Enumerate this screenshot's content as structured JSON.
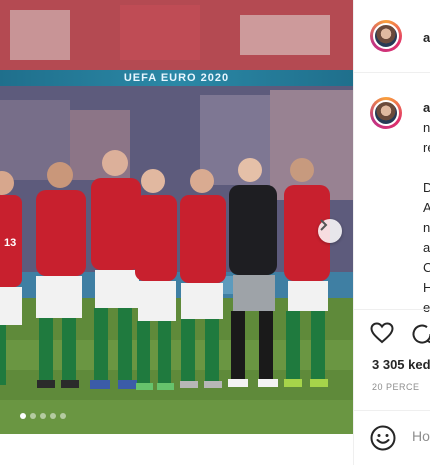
{
  "post": {
    "image_alt": "Hungary national football team lining up before a UEFA EURO 2020 match",
    "stadium_banner": "UEFA EURO 2020",
    "carousel": {
      "count": 5,
      "active_index": 0
    },
    "next_icon": "chevron-right-icon"
  },
  "header": {
    "username": "ad",
    "avatar_icon": "profile-avatar"
  },
  "caption": {
    "username": "a",
    "lines": [
      "n",
      "re",
      "",
      "D",
      "A",
      "n",
      "a",
      "C",
      "H",
      "e"
    ]
  },
  "actions": {
    "like_icon": "heart-icon",
    "comment_icon": "comment-icon"
  },
  "likes_text": "3 305 ked",
  "time_ago": "20 PERCE",
  "composer": {
    "emoji_icon": "smiley-icon",
    "placeholder": "Ho"
  },
  "colors": {
    "border": "#efefef",
    "text": "#262626",
    "muted": "#8e8e8e",
    "jersey_red": "#c8202e",
    "socks_green": "#1f7a3e",
    "keeper_black": "#1e1e22"
  }
}
